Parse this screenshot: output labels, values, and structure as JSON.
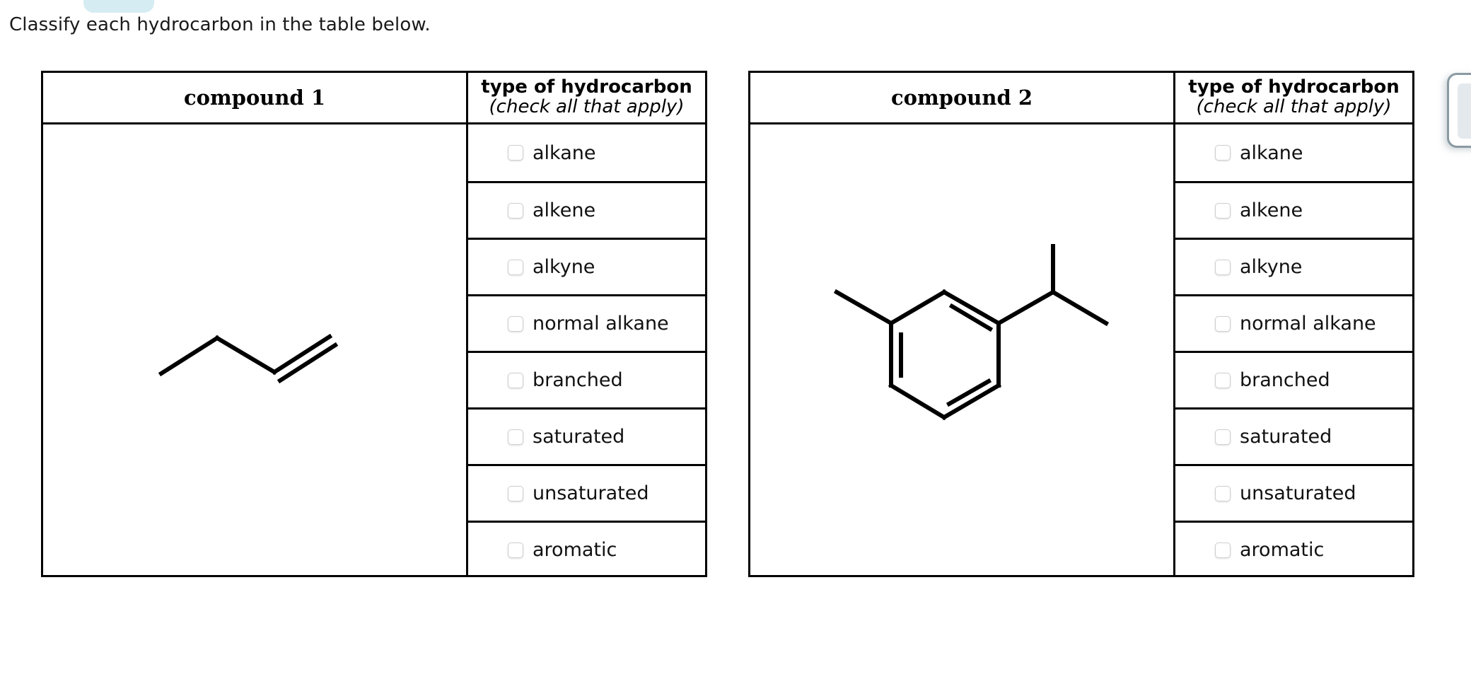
{
  "prompt": "Classify each hydrocarbon in the table below.",
  "top_pill": {
    "name": "partially-visible-blue-pill"
  },
  "edge_panel": {
    "name": "right-edge-floating-panel"
  },
  "hydrocarbon_types": [
    "alkane",
    "alkene",
    "alkyne",
    "normal alkane",
    "branched",
    "saturated",
    "unsaturated",
    "aromatic"
  ],
  "type_column_header": {
    "line1": "type of hydrocarbon",
    "line2": "(check all that apply)"
  },
  "tables": [
    {
      "compound_label": "compound 1",
      "structure": "1-butene skeletal structure: four-carbon zigzag chain with a terminal carbon-carbon double bond on the right",
      "checkbox_states": [
        false,
        false,
        false,
        false,
        false,
        false,
        false,
        false
      ]
    },
    {
      "compound_label": "compound 2",
      "structure": "m-cymene skeletal structure: benzene ring with alternating double bonds, a methyl substituent on the left and an isopropyl substituent on the upper right",
      "checkbox_states": [
        false,
        false,
        false,
        false,
        false,
        false,
        false,
        false
      ]
    }
  ],
  "colors": {
    "text": "#1a1a1a",
    "border": "#000000",
    "checkbox_border": "#cfcfcf",
    "pill": "#d6ecf3",
    "panel_border": "#8a9aa3",
    "background": "#ffffff"
  }
}
